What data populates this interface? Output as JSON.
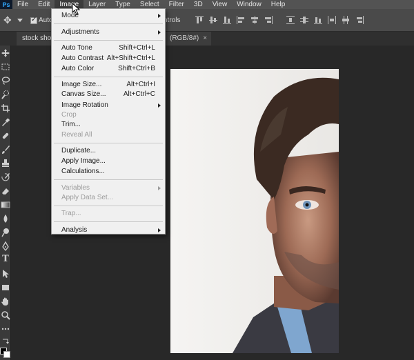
{
  "menubar": {
    "logo": "Ps",
    "items": [
      "File",
      "Edit",
      "Image",
      "Layer",
      "Type",
      "Select",
      "Filter",
      "3D",
      "View",
      "Window",
      "Help"
    ]
  },
  "options": {
    "auto_select_label": "Auto-",
    "controls_label": "ntrols"
  },
  "tabs": {
    "doc1": "stock shot",
    "doc2": "(RGB/8#)",
    "close": "×"
  },
  "image_menu": {
    "items": [
      {
        "label": "Mode",
        "shortcut": "",
        "submenu": true,
        "enabled": true
      },
      {
        "label": "Adjustments",
        "shortcut": "",
        "submenu": true,
        "enabled": true
      },
      {
        "label": "Auto Tone",
        "shortcut": "Shift+Ctrl+L",
        "submenu": false,
        "enabled": true
      },
      {
        "label": "Auto Contrast",
        "shortcut": "Alt+Shift+Ctrl+L",
        "submenu": false,
        "enabled": true
      },
      {
        "label": "Auto Color",
        "shortcut": "Shift+Ctrl+B",
        "submenu": false,
        "enabled": true
      },
      {
        "label": "Image Size...",
        "shortcut": "Alt+Ctrl+I",
        "submenu": false,
        "enabled": true
      },
      {
        "label": "Canvas Size...",
        "shortcut": "Alt+Ctrl+C",
        "submenu": false,
        "enabled": true
      },
      {
        "label": "Image Rotation",
        "shortcut": "",
        "submenu": true,
        "enabled": true
      },
      {
        "label": "Crop",
        "shortcut": "",
        "submenu": false,
        "enabled": false
      },
      {
        "label": "Trim...",
        "shortcut": "",
        "submenu": false,
        "enabled": true
      },
      {
        "label": "Reveal All",
        "shortcut": "",
        "submenu": false,
        "enabled": false
      },
      {
        "label": "Duplicate...",
        "shortcut": "",
        "submenu": false,
        "enabled": true
      },
      {
        "label": "Apply Image...",
        "shortcut": "",
        "submenu": false,
        "enabled": true
      },
      {
        "label": "Calculations...",
        "shortcut": "",
        "submenu": false,
        "enabled": true
      },
      {
        "label": "Variables",
        "shortcut": "",
        "submenu": true,
        "enabled": false
      },
      {
        "label": "Apply Data Set...",
        "shortcut": "",
        "submenu": false,
        "enabled": false
      },
      {
        "label": "Trap...",
        "shortcut": "",
        "submenu": false,
        "enabled": false
      },
      {
        "label": "Analysis",
        "shortcut": "",
        "submenu": true,
        "enabled": true
      }
    ]
  },
  "colors": {
    "menubar_bg": "#535353",
    "menu_bg": "#f0f0f0",
    "canvas_bg": "#282828"
  }
}
